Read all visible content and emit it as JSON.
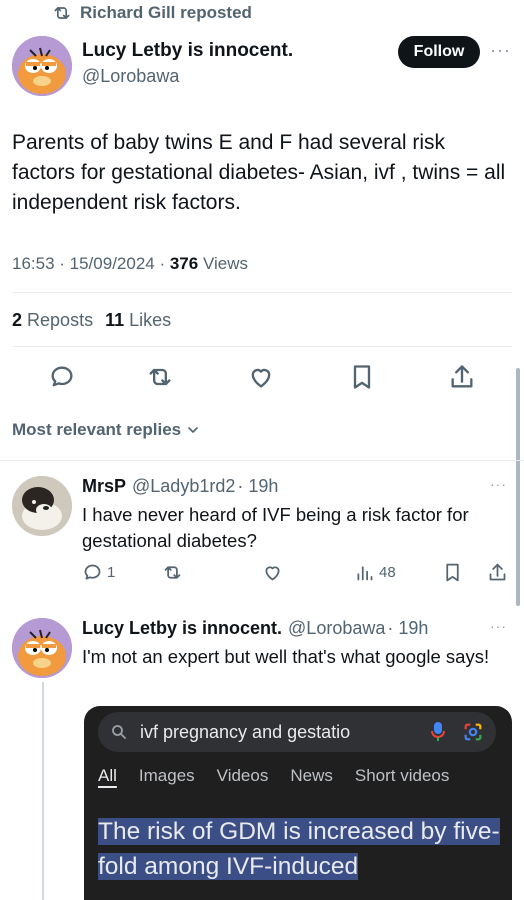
{
  "repost_banner": {
    "text": "Richard Gill reposted"
  },
  "main_tweet": {
    "author_name": "Lucy Letby is innocent.",
    "handle": "@Lorobawa",
    "follow_label": "Follow",
    "more": "···",
    "text": "Parents of baby twins E and F had several risk factors for gestational diabetes- Asian, ivf , twins = all independent risk factors.",
    "time": "16:53 · 15/09/2024 · ",
    "views_count": "376",
    "views_label": " Views",
    "reposts_count": "2",
    "reposts_label": "Reposts",
    "likes_count": "11",
    "likes_label": "Likes"
  },
  "sort": {
    "label": "Most relevant replies"
  },
  "replies": [
    {
      "author_name": "MrsP",
      "handle": "@Ladyb1rd2",
      "time": "· 19h",
      "text": "I have never heard of IVF being a risk factor for gestational diabetes?",
      "reply_count": "1",
      "views": "48",
      "more": "···"
    },
    {
      "author_name": "Lucy Letby is innocent.",
      "handle": "@Lorobawa",
      "time": "· 19h",
      "text": "I'm not an expert but well that's what google says!",
      "more": "···"
    }
  ],
  "embed": {
    "query": "ivf pregnancy and gestatio",
    "tabs": [
      "All",
      "Images",
      "Videos",
      "News",
      "Short videos"
    ],
    "answer": "The risk of GDM is increased by five-fold among IVF-induced"
  }
}
